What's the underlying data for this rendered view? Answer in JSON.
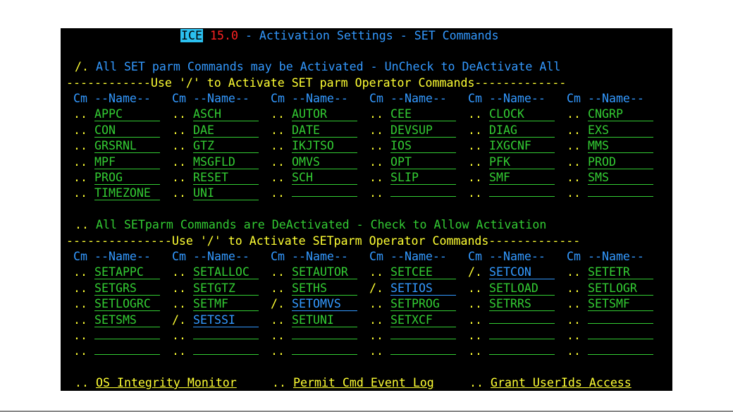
{
  "title": {
    "product": "ICE",
    "version": "15.0",
    "text": "- Activation Settings - SET Commands"
  },
  "section1": {
    "cmd": "/.",
    "message": "All SET parm Commands may be Activated - UnCheck to DeActivate All",
    "rule": "------------Use '/' to Activate SET parm Operator Commands-------------",
    "col_cm": "Cm",
    "col_name": "--Name--",
    "rows": [
      [
        {
          "cm": "..",
          "name": "APPC"
        },
        {
          "cm": "..",
          "name": "ASCH"
        },
        {
          "cm": "..",
          "name": "AUTOR"
        },
        {
          "cm": "..",
          "name": "CEE"
        },
        {
          "cm": "..",
          "name": "CLOCK"
        },
        {
          "cm": "..",
          "name": "CNGRP"
        }
      ],
      [
        {
          "cm": "..",
          "name": "CON"
        },
        {
          "cm": "..",
          "name": "DAE"
        },
        {
          "cm": "..",
          "name": "DATE"
        },
        {
          "cm": "..",
          "name": "DEVSUP"
        },
        {
          "cm": "..",
          "name": "DIAG"
        },
        {
          "cm": "..",
          "name": "EXS"
        }
      ],
      [
        {
          "cm": "..",
          "name": "GRSRNL"
        },
        {
          "cm": "..",
          "name": "GTZ"
        },
        {
          "cm": "..",
          "name": "IKJTSO"
        },
        {
          "cm": "..",
          "name": "IOS"
        },
        {
          "cm": "..",
          "name": "IXGCNF"
        },
        {
          "cm": "..",
          "name": "MMS"
        }
      ],
      [
        {
          "cm": "..",
          "name": "MPF"
        },
        {
          "cm": "..",
          "name": "MSGFLD"
        },
        {
          "cm": "..",
          "name": "OMVS"
        },
        {
          "cm": "..",
          "name": "OPT"
        },
        {
          "cm": "..",
          "name": "PFK"
        },
        {
          "cm": "..",
          "name": "PROD"
        }
      ],
      [
        {
          "cm": "..",
          "name": "PROG"
        },
        {
          "cm": "..",
          "name": "RESET"
        },
        {
          "cm": "..",
          "name": "SCH"
        },
        {
          "cm": "..",
          "name": "SLIP"
        },
        {
          "cm": "..",
          "name": "SMF"
        },
        {
          "cm": "..",
          "name": "SMS"
        }
      ],
      [
        {
          "cm": "..",
          "name": "TIMEZONE"
        },
        {
          "cm": "..",
          "name": "UNI"
        },
        {
          "cm": "..",
          "name": ""
        },
        {
          "cm": "..",
          "name": ""
        },
        {
          "cm": "..",
          "name": ""
        },
        {
          "cm": "..",
          "name": ""
        }
      ]
    ]
  },
  "section2": {
    "cmd": "..",
    "message": "All SETparm Commands are DeActivated - Check to Allow Activation",
    "rule": "---------------Use '/' to Activate SETparm Operator Commands-------------",
    "col_cm": "Cm",
    "col_name": "--Name--",
    "rows": [
      [
        {
          "cm": "..",
          "name": "SETAPPC"
        },
        {
          "cm": "..",
          "name": "SETALLOC"
        },
        {
          "cm": "..",
          "name": "SETAUTOR"
        },
        {
          "cm": "..",
          "name": "SETCEE"
        },
        {
          "cm": "/.",
          "name": "SETCON",
          "on": true
        },
        {
          "cm": "..",
          "name": "SETETR"
        }
      ],
      [
        {
          "cm": "..",
          "name": "SETGRS"
        },
        {
          "cm": "..",
          "name": "SETGTZ"
        },
        {
          "cm": "..",
          "name": "SETHS"
        },
        {
          "cm": "/.",
          "name": "SETIOS",
          "on": true
        },
        {
          "cm": "..",
          "name": "SETLOAD"
        },
        {
          "cm": "..",
          "name": "SETLOGR"
        }
      ],
      [
        {
          "cm": "..",
          "name": "SETLOGRC"
        },
        {
          "cm": "..",
          "name": "SETMF"
        },
        {
          "cm": "/.",
          "name": "SETOMVS",
          "on": true
        },
        {
          "cm": "..",
          "name": "SETPROG"
        },
        {
          "cm": "..",
          "name": "SETRRS"
        },
        {
          "cm": "..",
          "name": "SETSMF"
        }
      ],
      [
        {
          "cm": "..",
          "name": "SETSMS"
        },
        {
          "cm": "/.",
          "name": "SETSSI",
          "on": true
        },
        {
          "cm": "..",
          "name": "SETUNI"
        },
        {
          "cm": "..",
          "name": "SETXCF"
        },
        {
          "cm": "..",
          "name": ""
        },
        {
          "cm": "..",
          "name": ""
        }
      ],
      [
        {
          "cm": "..",
          "name": ""
        },
        {
          "cm": "..",
          "name": ""
        },
        {
          "cm": "..",
          "name": ""
        },
        {
          "cm": "..",
          "name": ""
        },
        {
          "cm": "..",
          "name": ""
        },
        {
          "cm": "..",
          "name": ""
        }
      ],
      [
        {
          "cm": "..",
          "name": ""
        },
        {
          "cm": "..",
          "name": ""
        },
        {
          "cm": "..",
          "name": ""
        },
        {
          "cm": "..",
          "name": ""
        },
        {
          "cm": "..",
          "name": ""
        },
        {
          "cm": "..",
          "name": ""
        }
      ]
    ]
  },
  "footer": {
    "items": [
      {
        "cm": "..",
        "label": "OS Integrity Monitor"
      },
      {
        "cm": "..",
        "label": "Permit Cmd Event Log"
      },
      {
        "cm": "..",
        "label": "Grant UserIds Access"
      }
    ]
  },
  "colors": {
    "screen_bg": "#000000",
    "green": "#33cc33",
    "blue": "#3399ff",
    "yellow": "#ffff33",
    "red": "#ff2222",
    "ice_badge": "#2bc0f0"
  }
}
